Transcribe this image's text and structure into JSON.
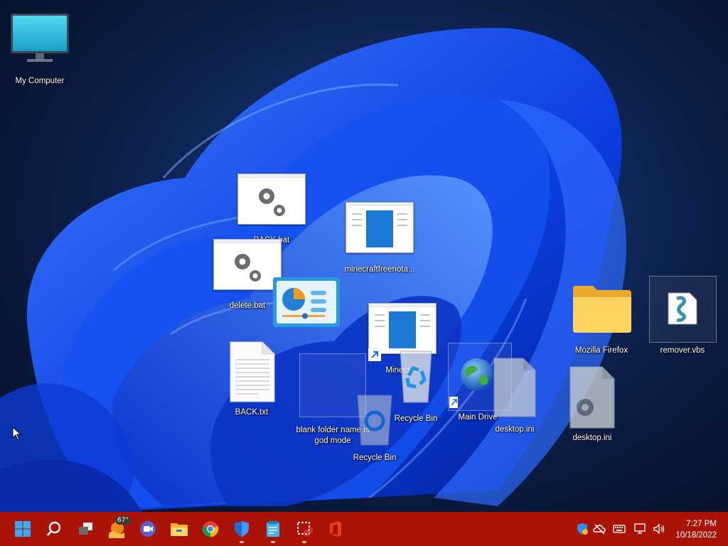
{
  "desktop": {
    "icons": {
      "my_computer": "My Computer",
      "back_bat": "BACK.bat",
      "minecraft_free": "minecraftfreenota...",
      "delete_bat": "delete.bat",
      "minecraft": "Minecraft",
      "back_txt": "BACK.txt",
      "god_mode": "blank folder name is god mode",
      "recycle_bin_1": "Recycle Bin",
      "recycle_bin_2": "Recycle Bin",
      "main_drive": "Main Drive",
      "desktop_ini_1": "desktop.ini",
      "desktop_ini_2": "desktop.ini",
      "mozilla_firefox": "Mozilla Firefox",
      "remover_vbs": "remover.vbs"
    }
  },
  "taskbar": {
    "weather_temp": "67°",
    "clock_time": "7:27 PM",
    "clock_date": "10/18/2022",
    "colors": {
      "taskbar": "#a91407",
      "accent": "#0a64d8"
    },
    "icons": [
      "start-icon",
      "search-icon",
      "task-view-icon",
      "weather-icon",
      "meet-icon",
      "file-explorer-icon",
      "chrome-icon",
      "defender-icon",
      "notepad-icon",
      "snipping-icon",
      "office-icon"
    ]
  }
}
